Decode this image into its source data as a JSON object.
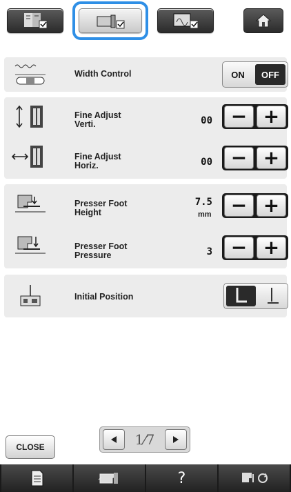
{
  "tabs": [
    {
      "icon": "book-settings-icon"
    },
    {
      "icon": "sewing-machine-settings-icon"
    },
    {
      "icon": "embroidery-settings-icon"
    }
  ],
  "home_icon": "home-icon",
  "rows": {
    "width_control": {
      "label": "Width Control",
      "on_label": "ON",
      "off_label": "OFF",
      "state": "OFF"
    },
    "fine_adjust_verti": {
      "label_line1": "Fine Adjust",
      "label_line2": "Verti.",
      "value": "00"
    },
    "fine_adjust_horiz": {
      "label_line1": "Fine Adjust",
      "label_line2": "Horiz.",
      "value": "00"
    },
    "presser_foot_height": {
      "label_line1": "Presser Foot",
      "label_line2": "Height",
      "value": "7.5",
      "unit": "mm"
    },
    "presser_foot_pressure": {
      "label_line1": "Presser Foot",
      "label_line2": "Pressure",
      "value": "3"
    },
    "initial_position": {
      "label": "Initial Position",
      "selected": "left"
    }
  },
  "stepper": {
    "minus": "−",
    "plus": "+"
  },
  "pager": {
    "current": "1",
    "total": "7",
    "text": "1⁄7"
  },
  "close_label": "CLOSE",
  "bottom_bar": {
    "help_label": "?"
  },
  "colors": {
    "selected_tab_outline": "#2f8fe6",
    "panel": "#ececec",
    "dark": "#1a1a1a"
  }
}
